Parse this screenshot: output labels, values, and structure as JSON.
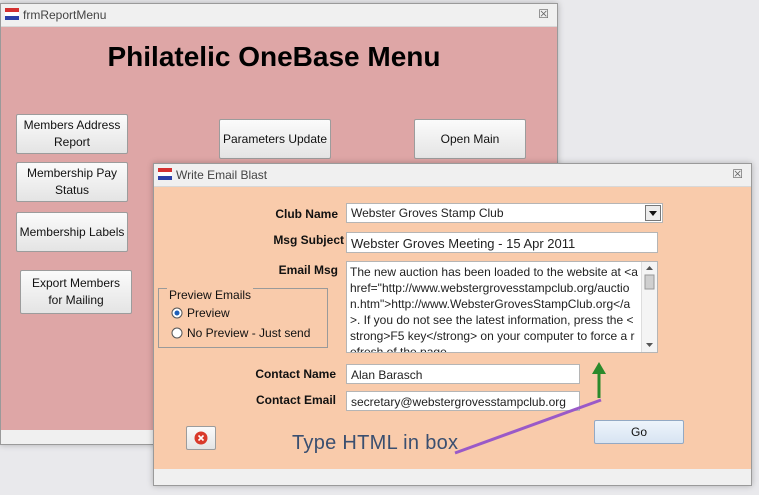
{
  "report_menu": {
    "window_title": "frmReportMenu",
    "heading": "Philatelic OneBase Menu",
    "buttons": {
      "members_address_report": "Members Address Report",
      "parameters_update": "Parameters Update",
      "open_main": "Open Main",
      "membership_pay_status": "Membership Pay Status",
      "membership_labels": "Membership Labels",
      "export_members": "Export Members for Mailing"
    },
    "close_glyph": "☒"
  },
  "email_blast": {
    "window_title": "Write Email Blast",
    "close_glyph": "☒",
    "club_name_label": "Club Name",
    "club_name_value": "Webster Groves Stamp Club",
    "msg_subject_label": "Msg Subject",
    "msg_subject_value": "Webster Groves Meeting - 15 Apr 2011",
    "email_msg_label": "Email Msg",
    "email_msg_value": "The new auction has been loaded to the website at <a href=\"http://www.webstergrovesstampclub.org/auction.htm\">http://www.WebsterGrovesStampClub.org</a>. If you do not see the latest information, press the <strong>F5 key</strong> on your computer to force a refresh of the page.",
    "preview_group_label": "Preview Emails",
    "preview_option": "Preview",
    "no_preview_option": "No Preview - Just send",
    "contact_name_label": "Contact Name",
    "contact_name_value": "Alan Barasch",
    "contact_email_label": "Contact Email",
    "contact_email_value": "secretary@webstergrovesstampclub.org",
    "go_label": "Go"
  },
  "annotation": {
    "text": "Type HTML in box"
  },
  "colors": {
    "report_bg": "#dea6a6",
    "email_bg": "#f9cbab",
    "arrow_green": "#2b8a2b",
    "arrow_purple": "#9a5ac8"
  }
}
